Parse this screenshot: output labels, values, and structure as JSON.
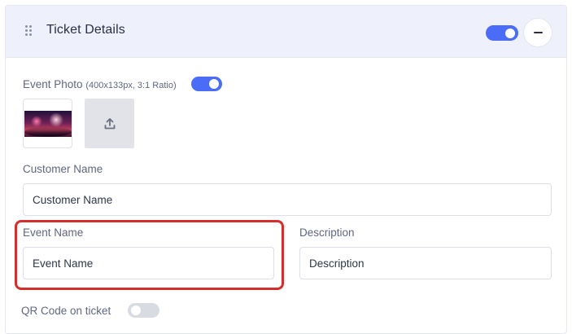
{
  "header": {
    "title": "Ticket Details",
    "enabled": true,
    "collapse_icon": "minus-icon",
    "drag_icon": "drag-handle-icon"
  },
  "event_photo": {
    "label": "Event Photo",
    "hint": "(400x133px, 3:1 Ratio)",
    "enabled": true,
    "upload_icon": "upload-icon"
  },
  "customer_name": {
    "label": "Customer Name",
    "placeholder": "Customer Name"
  },
  "event_name": {
    "label": "Event Name",
    "placeholder": "Event Name"
  },
  "description": {
    "label": "Description",
    "placeholder": "Description"
  },
  "qr_code": {
    "label": "QR Code on ticket",
    "enabled": false
  },
  "colors": {
    "accent": "#4a6cf7",
    "header_bg": "#eef0fb",
    "highlight": "#d32f2f"
  }
}
